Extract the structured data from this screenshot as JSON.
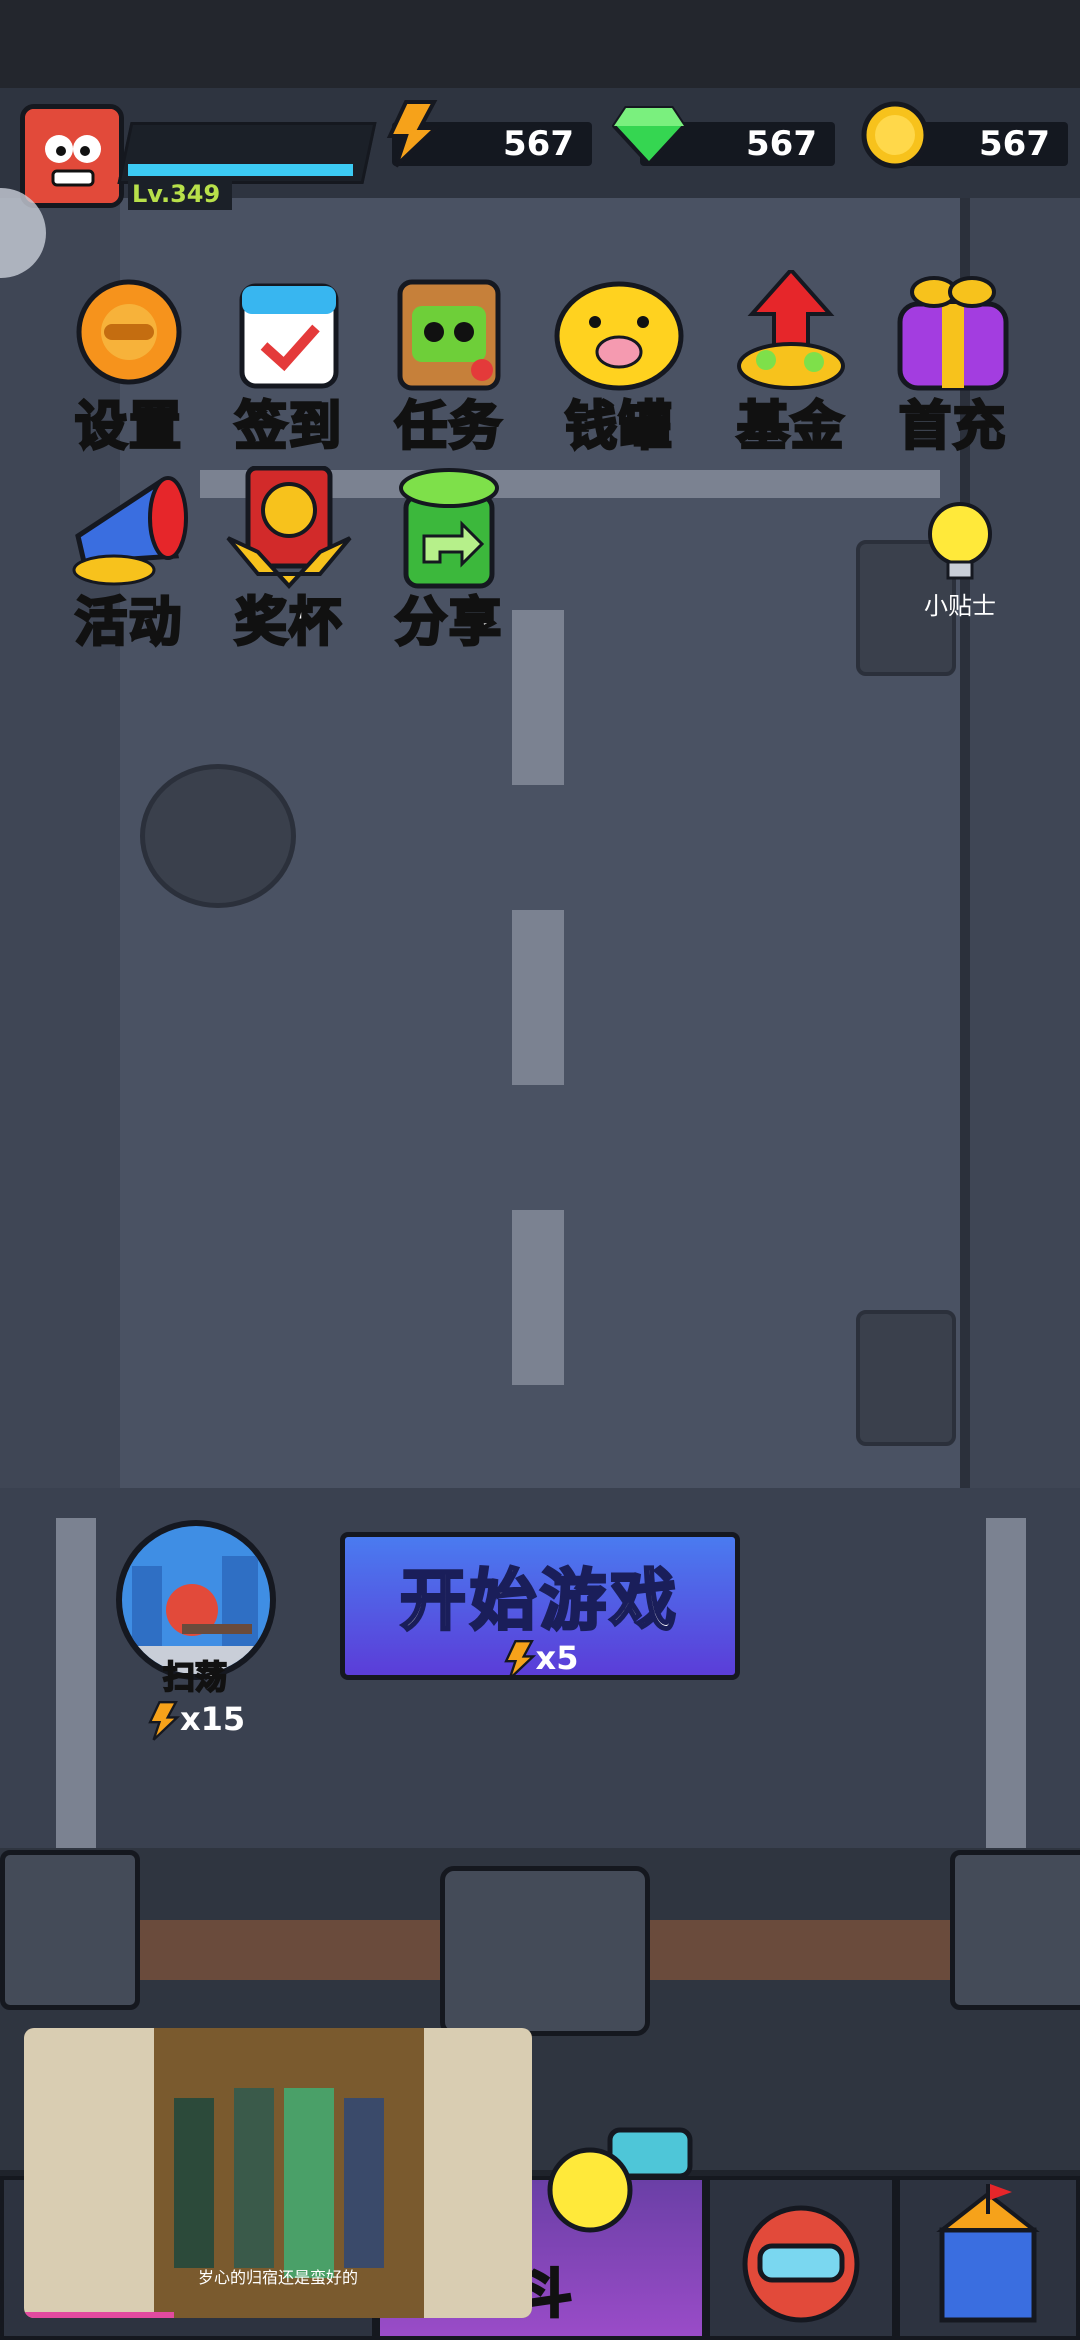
{
  "player": {
    "level": "Lv.349"
  },
  "resources": {
    "energy": "567",
    "gems": "567",
    "coins": "567"
  },
  "menu_row1": [
    {
      "label": "设置",
      "icon": "gear-icon"
    },
    {
      "label": "签到",
      "icon": "calendar-icon"
    },
    {
      "label": "任务",
      "icon": "task-board-icon"
    },
    {
      "label": "钱罐",
      "icon": "piggy-bank-icon"
    },
    {
      "label": "基金",
      "icon": "fund-icon"
    },
    {
      "label": "首充",
      "icon": "gift-icon"
    }
  ],
  "menu_row2": [
    {
      "label": "活动",
      "icon": "megaphone-icon"
    },
    {
      "label": "奖杯",
      "icon": "trophy-icon"
    },
    {
      "label": "分享",
      "icon": "share-icon"
    }
  ],
  "tip": {
    "label": "小贴士"
  },
  "start": {
    "label": "开始游戏",
    "cost": "x5"
  },
  "sweep": {
    "label": "扫荡",
    "cost": "x15"
  },
  "video": {
    "subtitle": "岁心的归宿还是蛮好的"
  },
  "nav": {
    "battle_label": "斗"
  },
  "colors": {
    "xp": "#3ccbf4",
    "level": "#b8e04a",
    "start_top": "#4a7bf0",
    "start_bottom": "#5b3dd8"
  }
}
